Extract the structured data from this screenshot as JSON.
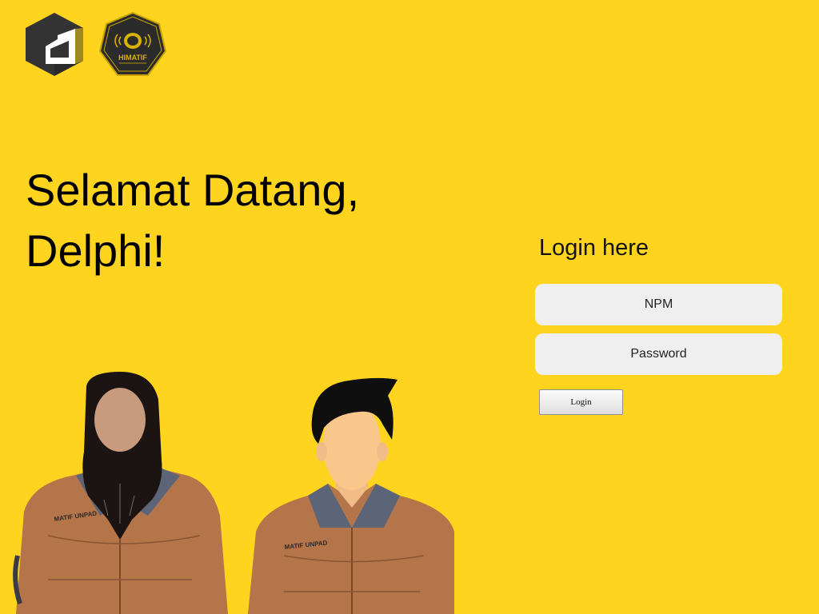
{
  "logos": {
    "brand_icon": "delphi-cube-logo",
    "badge_icon": "himatif-badge-logo",
    "badge_text": "HIMATIF"
  },
  "hero": {
    "line1": "Selamat Datang,",
    "line2": "Delphi!"
  },
  "login": {
    "title": "Login here",
    "npm_placeholder": "NPM",
    "npm_value": "",
    "password_placeholder": "Password",
    "password_value": "",
    "button_label": "Login"
  },
  "illustration": {
    "jacket_text_left": "MATIF UNPAD",
    "jacket_text_right": "MATIF UNPAD"
  },
  "colors": {
    "background": "#FFD41F",
    "field": "#EFEFEF",
    "jacket": "#B5754A",
    "collar": "#5C6577"
  }
}
